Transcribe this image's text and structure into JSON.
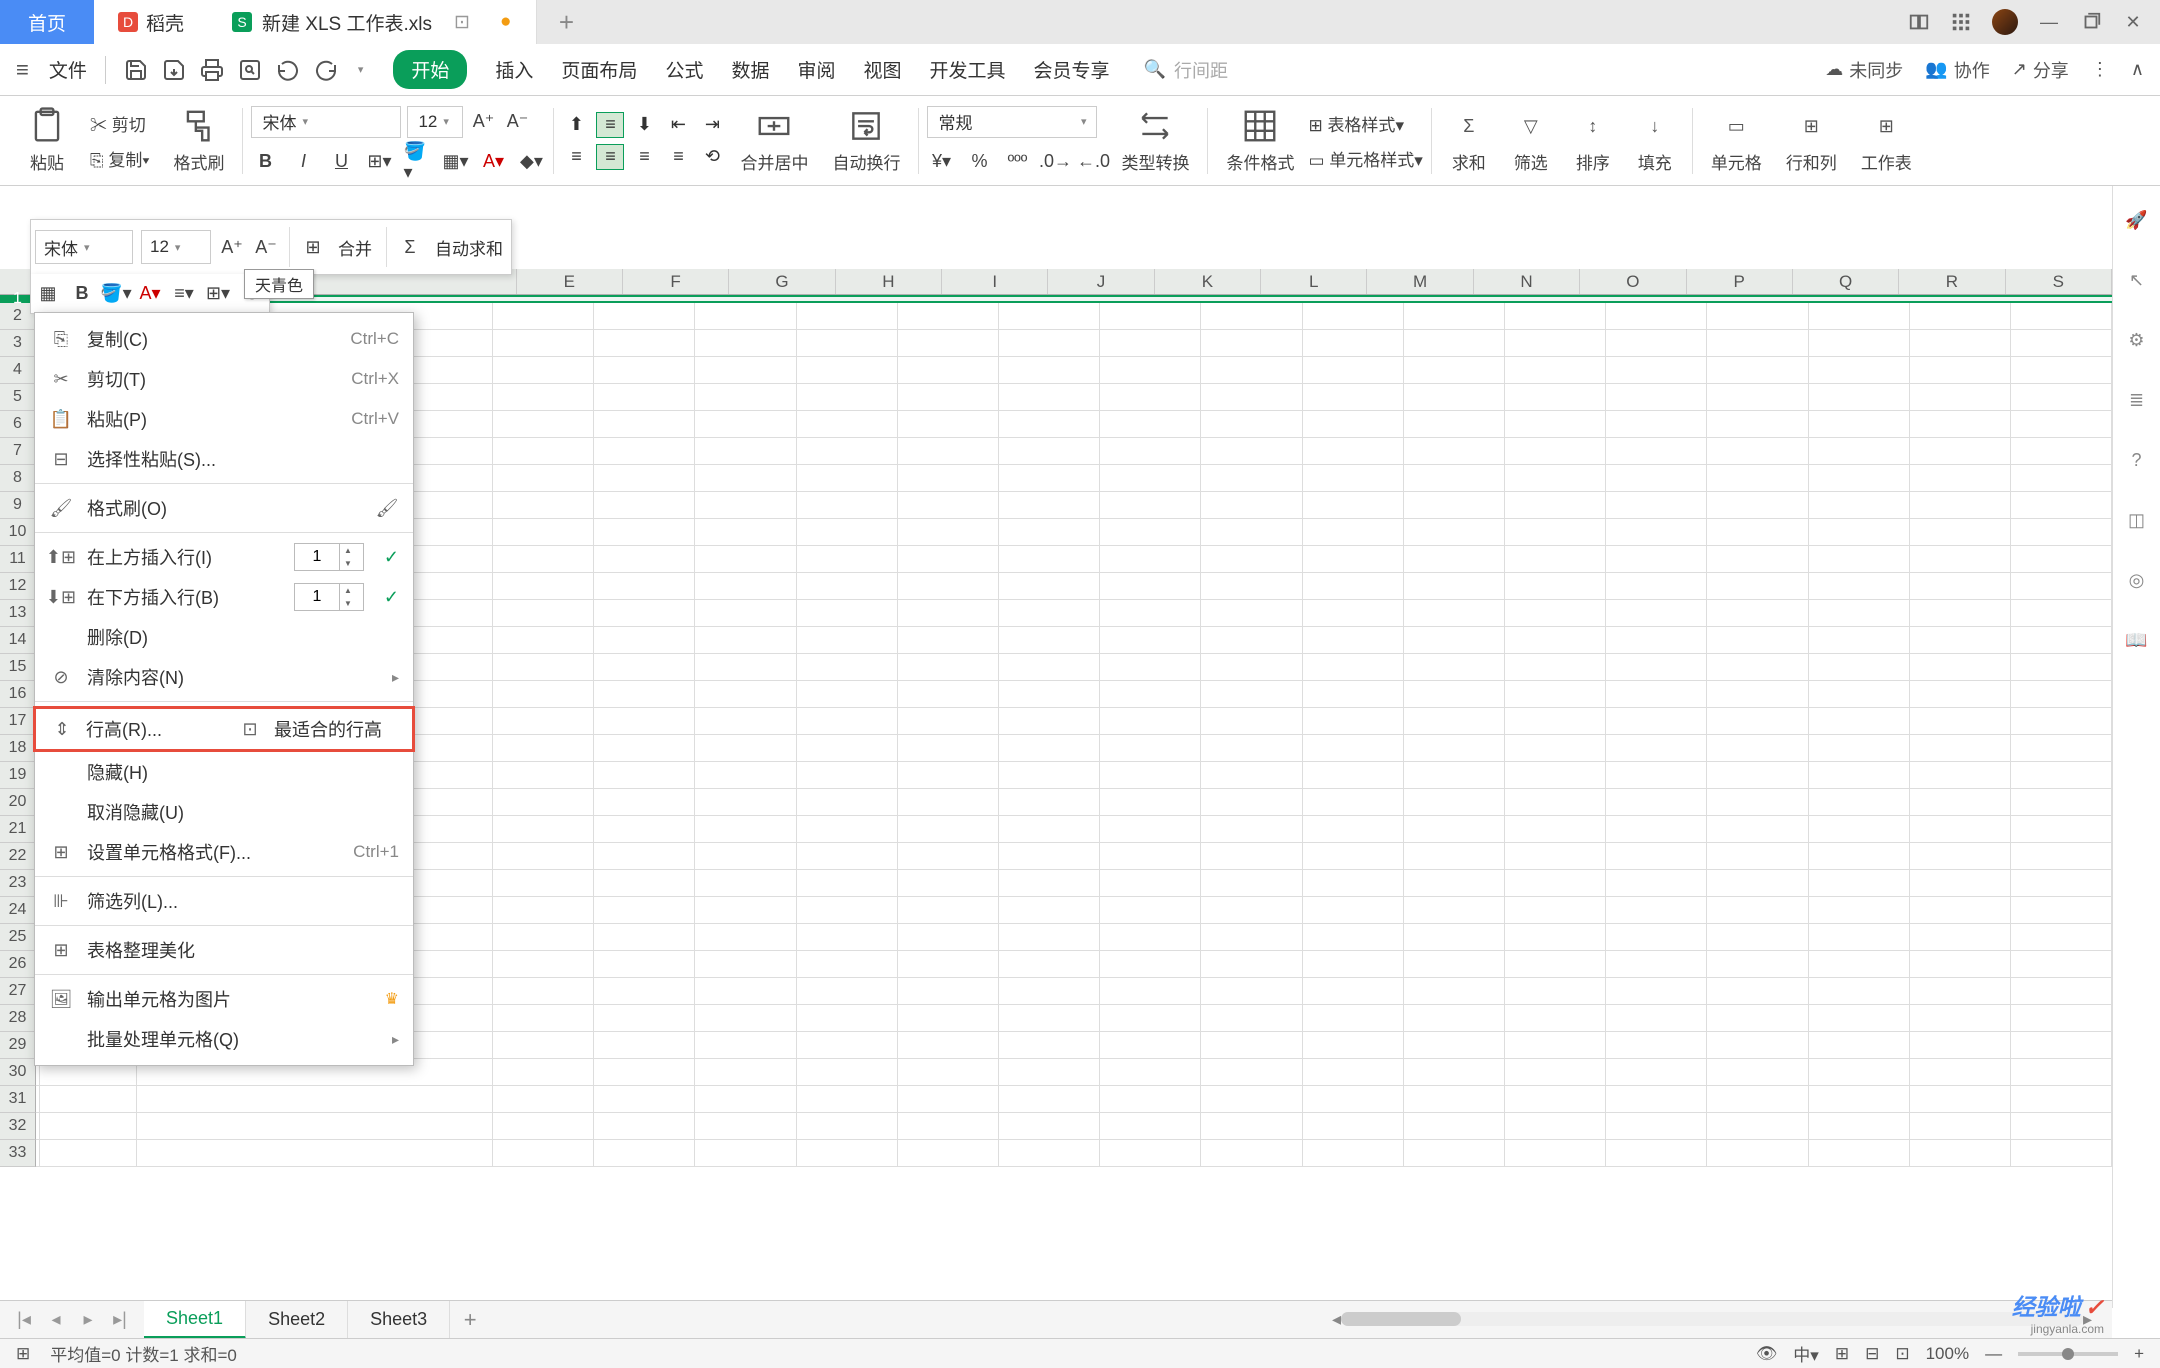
{
  "titlebar": {
    "home": "首页",
    "doke": "稻壳",
    "file": "新建 XLS 工作表.xls"
  },
  "menubar": {
    "file": "文件",
    "tabs": [
      "开始",
      "插入",
      "页面布局",
      "公式",
      "数据",
      "审阅",
      "视图",
      "开发工具",
      "会员专享"
    ],
    "search_placeholder": "行间距",
    "unsync": "未同步",
    "collab": "协作",
    "share": "分享"
  },
  "ribbon": {
    "cut": "剪切",
    "paste": "粘贴",
    "copy": "复制",
    "fmt_paint": "格式刷",
    "font_name": "宋体",
    "font_size": "12",
    "merge": "合并居中",
    "wrap": "自动换行",
    "general": "常规",
    "type_conv": "类型转换",
    "cond_fmt": "条件格式",
    "table_style": "表格样式",
    "cell_style": "单元格样式",
    "sum": "求和",
    "filter": "筛选",
    "sort": "排序",
    "fill": "填充",
    "cell": "单元格",
    "rowcol": "行和列",
    "worksheet": "工作表"
  },
  "floatbar": {
    "font_name": "宋体",
    "font_size": "12",
    "merge": "合并",
    "autosum": "自动求和"
  },
  "tooltip": "天青色",
  "columns": [
    "E",
    "F",
    "G",
    "H",
    "I",
    "J",
    "K",
    "L",
    "M",
    "N",
    "O",
    "P",
    "Q",
    "R",
    "S"
  ],
  "rows_before": [
    2,
    3,
    4,
    5,
    6,
    7,
    8,
    9,
    10,
    11,
    12,
    13,
    14,
    15,
    16,
    17,
    18,
    19,
    20,
    21,
    22,
    23,
    24,
    25
  ],
  "rows_after": [
    26,
    27,
    28,
    29,
    30,
    31,
    32,
    33
  ],
  "row_sel": 1,
  "ctx": {
    "copy": "复制(C)",
    "copy_sc": "Ctrl+C",
    "cut": "剪切(T)",
    "cut_sc": "Ctrl+X",
    "paste": "粘贴(P)",
    "paste_sc": "Ctrl+V",
    "paste_special": "选择性粘贴(S)...",
    "fmt_paint": "格式刷(O)",
    "insert_above": "在上方插入行(I)",
    "insert_above_val": "1",
    "insert_below": "在下方插入行(B)",
    "insert_below_val": "1",
    "delete": "删除(D)",
    "clear": "清除内容(N)",
    "row_height": "行高(R)...",
    "best_height": "最适合的行高",
    "hide": "隐藏(H)",
    "unhide": "取消隐藏(U)",
    "cell_format": "设置单元格格式(F)...",
    "cell_format_sc": "Ctrl+1",
    "filter_col": "筛选列(L)...",
    "beautify": "表格整理美化",
    "export_img": "输出单元格为图片",
    "batch": "批量处理单元格(Q)"
  },
  "sheets": [
    "Sheet1",
    "Sheet2",
    "Sheet3"
  ],
  "status": {
    "stats": "平均值=0  计数=1  求和=0",
    "zoom": "100%"
  },
  "watermark": {
    "a": "经验啦",
    "b": "✓",
    "url": "jingyanla.com"
  }
}
